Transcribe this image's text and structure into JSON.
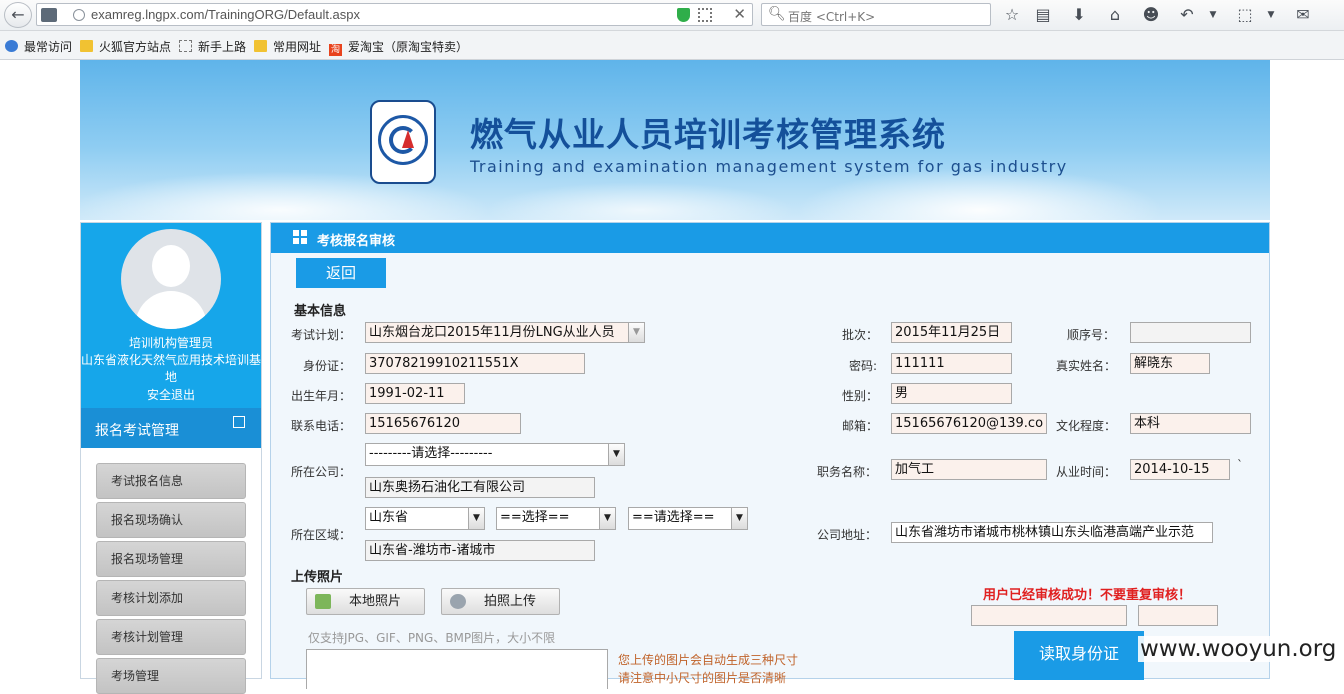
{
  "browser": {
    "url": "examreg.lngpx.com/TrainingORG/Default.aspx",
    "search_placeholder": "百度 <Ctrl+K>",
    "bookmarks": [
      "最常访问",
      "火狐官方站点",
      "新手上路",
      "常用网址",
      "爱淘宝（原淘宝特卖）"
    ],
    "taobao_icon_text": "淘"
  },
  "banner": {
    "title": "燃气从业人员培训考核管理系统",
    "subtitle": "Training and examination management system for gas industry"
  },
  "sidebar": {
    "role": "培训机构管理员",
    "org": "山东省液化天然气应用技术培训基地",
    "logout": "安全退出",
    "menu_title": "报名考试管理",
    "items": [
      "考试报名信息",
      "报名现场确认",
      "报名现场管理",
      "考核计划添加",
      "考核计划管理",
      "考场管理"
    ]
  },
  "panel": {
    "title": "考核报名审核",
    "back_button": "返回",
    "basic_info": "基本信息",
    "labels": {
      "plan": "考试计划：",
      "id_card": "身份证：",
      "birth": "出生年月：",
      "phone": "联系电话：",
      "company": "所在公司：",
      "region": "所在区域：",
      "batch": "批次：",
      "password": "密码:",
      "gender": "性别：",
      "email": "邮箱：",
      "job": "职务名称：",
      "address": "公司地址：",
      "seq": "顺序号：",
      "real_name": "真实姓名：",
      "education": "文化程度：",
      "work_since": "从业时间："
    },
    "values": {
      "plan": "山东烟台龙口2015年11月份LNG从业人员",
      "id_card": "37078219910211551X",
      "birth": "1991-02-11",
      "phone": "15165676120",
      "company_select": "---------请选择---------",
      "company": "山东奥扬石油化工有限公司",
      "province": "山东省",
      "city_select": "==选择==",
      "district_select": "==请选择==",
      "region": "山东省-潍坊市-诸城市",
      "batch": "2015年11月25日",
      "password": "111111",
      "gender": "男",
      "email": "15165676120@139.co",
      "job": "加气工",
      "address": "山东省潍坊市诸城市桃林镇山东头临港高端产业示范",
      "seq": "",
      "real_name": "解晓东",
      "education": "本科",
      "work_since": "2014-10-15",
      "work_since_mark": "`"
    },
    "upload": {
      "title": "上传照片",
      "local_button": "本地照片",
      "camera_button": "拍照上传",
      "hint": "仅支持JPG、GIF、PNG、BMP图片，大小不限",
      "note1": "您上传的图片会自动生成三种尺寸",
      "note2": "请注意中小尺寸的图片是否清晰"
    },
    "notice": "用户已经审核成功！不要重复审核！",
    "read_id_button": "读取身份证"
  },
  "watermark": "www.wooyun.org"
}
